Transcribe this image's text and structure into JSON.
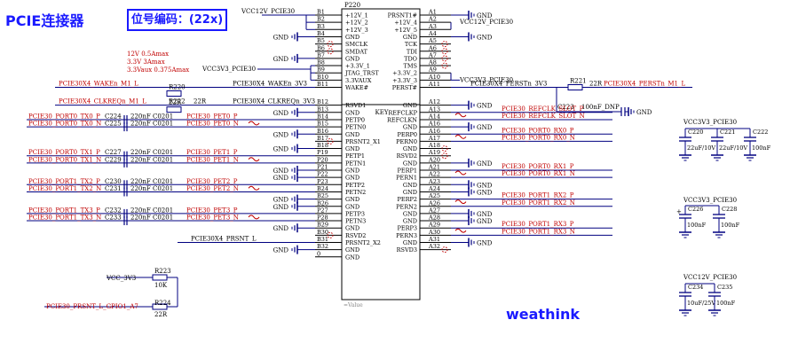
{
  "title": "PCIE连接器",
  "ref_label": "位号编码：(22x)",
  "brand": "weathink",
  "connector": {
    "ref": "P220",
    "key": "KEY",
    "value": "=Value",
    "left_pins": [
      {
        "num": "B1",
        "name": "+12V_1",
        "net": "VCC12V_PCIE30"
      },
      {
        "num": "B2",
        "name": "+12V_2",
        "net": ""
      },
      {
        "num": "B3",
        "name": "+12V_3",
        "net": ""
      },
      {
        "num": "B4",
        "name": "GND",
        "net": "GND"
      },
      {
        "num": "B5",
        "name": "SMCLK",
        "net": ""
      },
      {
        "num": "B6",
        "name": "SMDAT",
        "net": ""
      },
      {
        "num": "B7",
        "name": "GND",
        "net": "GND"
      },
      {
        "num": "B8",
        "name": "+3.3V_1",
        "net": "VCC3V3_PCIE30"
      },
      {
        "num": "B9",
        "name": "JTAG_TRST",
        "net": ""
      },
      {
        "num": "B10",
        "name": "3.3VAUX",
        "net": ""
      },
      {
        "num": "B11",
        "name": "WAKE#",
        "net": "PCIE30X4_WAKEn_3V3"
      },
      {
        "num": "B12",
        "name": "RSVD1",
        "net": "PCIE30X4_CLKREQn_3V3"
      },
      {
        "num": "B13",
        "name": "GND",
        "net": "GND"
      },
      {
        "num": "B14",
        "name": "PETP0",
        "net": "PCIE30_PET0_P"
      },
      {
        "num": "B15",
        "name": "PETN0",
        "net": "PCIE30_PET0_N"
      },
      {
        "num": "B16",
        "name": "GND",
        "net": "GND"
      },
      {
        "num": "B17",
        "name": "PRSNT2_X1",
        "net": ""
      },
      {
        "num": "B18",
        "name": "GND",
        "net": "GND"
      },
      {
        "num": "P19",
        "name": "PETP1",
        "net": "PCIE30_PET1_P"
      },
      {
        "num": "P20",
        "name": "PETN1",
        "net": "PCIE30_PET1_N"
      },
      {
        "num": "P21",
        "name": "GND",
        "net": "GND"
      },
      {
        "num": "P22",
        "name": "GND",
        "net": "GND"
      },
      {
        "num": "P23",
        "name": "PETP2",
        "net": "PCIE30_PET2_P"
      },
      {
        "num": "B24",
        "name": "PETN2",
        "net": "PCIE30_PET2_N"
      },
      {
        "num": "B25",
        "name": "GND",
        "net": "GND"
      },
      {
        "num": "B26",
        "name": "GND",
        "net": "GND"
      },
      {
        "num": "P27",
        "name": "PETP3",
        "net": "PCIE30_PET3_P"
      },
      {
        "num": "P28",
        "name": "PETN3",
        "net": "PCIE30_PET3_N"
      },
      {
        "num": "B29",
        "name": "GND",
        "net": "GND"
      },
      {
        "num": "B30",
        "name": "RSVD2",
        "net": ""
      },
      {
        "num": "B31",
        "name": "PRSNT2_X2",
        "net": "PCIE30X4_PRSNT_L"
      },
      {
        "num": "B32",
        "name": "GND",
        "net": "GND"
      },
      {
        "num": "0",
        "name": "GND",
        "net": ""
      }
    ],
    "right_pins": [
      {
        "num": "A1",
        "name": "PRSNT1#",
        "net": "GND"
      },
      {
        "num": "A2",
        "name": "+12V_4",
        "net": "VCC12V_PCIE30"
      },
      {
        "num": "A3",
        "name": "+12V_5",
        "net": ""
      },
      {
        "num": "A4",
        "name": "GND",
        "net": "GND"
      },
      {
        "num": "A5",
        "name": "TCK",
        "net": ""
      },
      {
        "num": "A6",
        "name": "TDI",
        "net": ""
      },
      {
        "num": "A7",
        "name": "TDO",
        "net": ""
      },
      {
        "num": "A8",
        "name": "TMS",
        "net": ""
      },
      {
        "num": "A9",
        "name": "+3.3V_2",
        "net": ""
      },
      {
        "num": "A10",
        "name": "+3.3V_3",
        "net": "VCC3V3_PCIE30"
      },
      {
        "num": "A11",
        "name": "PERST#",
        "net": "PCIE30X4_PERSTn_3V3"
      },
      {
        "num": "A12",
        "name": "GND",
        "net": "GND"
      },
      {
        "num": "A13",
        "name": "REFCLKP",
        "net": "PCIE30_REFCLK_SLOT_P"
      },
      {
        "num": "A14",
        "name": "REFCLKN",
        "net": "PCIE30_REFCLK_SLOT_N"
      },
      {
        "num": "A16",
        "name": "GND",
        "net": "GND"
      },
      {
        "num": "A16",
        "name": "PERP0",
        "net": "PCIE30_PORT0_RX0_P"
      },
      {
        "num": "A17",
        "name": "PERN0",
        "net": "PCIE30_PORT0_RX0_N"
      },
      {
        "num": "A18",
        "name": "GND",
        "net": ""
      },
      {
        "num": "A19",
        "name": "RSVD2",
        "net": ""
      },
      {
        "num": "A20",
        "name": "GND",
        "net": "GND"
      },
      {
        "num": "A21",
        "name": "PERP1",
        "net": "PCIE30_PORT0_RX1_P"
      },
      {
        "num": "A22",
        "name": "PERN1",
        "net": "PCIE30_PORT0_RX1_N"
      },
      {
        "num": "A23",
        "name": "GND",
        "net": "GND"
      },
      {
        "num": "A24",
        "name": "GND",
        "net": "GND"
      },
      {
        "num": "A25",
        "name": "PERP2",
        "net": "PCIE30_PORT1_RX2_P"
      },
      {
        "num": "A26",
        "name": "PERN2",
        "net": "PCIE30_PORT1_RX2_N"
      },
      {
        "num": "A27",
        "name": "GND",
        "net": "GND"
      },
      {
        "num": "A28",
        "name": "GND",
        "net": "GND"
      },
      {
        "num": "A29",
        "name": "PERP3",
        "net": "PCIE30_PORT1_RX3_P"
      },
      {
        "num": "A30",
        "name": "PERN3",
        "net": "PCIE30_PORT1_RX3_N"
      },
      {
        "num": "A31",
        "name": "GND",
        "net": "GND"
      },
      {
        "num": "A32",
        "name": "RSVD3",
        "net": ""
      }
    ]
  },
  "left_inputs": [
    {
      "net": "PCIE30X4_WAKEn_M1_L",
      "ref": "R220",
      "value": "22R"
    },
    {
      "net": "PCIE30X4_CLKREQn_M1_L",
      "ref": "R222",
      "value": "22R"
    },
    {
      "net": "VCC_3V3",
      "ref": "R223",
      "value": "10K"
    },
    {
      "net": "PCIE30_PRSNT_L_GPIO1_A7",
      "ref": "R224",
      "value": "22R"
    }
  ],
  "tx_caps": [
    {
      "net": "PCIE30_PORT0_TX0_P",
      "ref": "C224",
      "value": "220nF",
      "pkg": "C0201"
    },
    {
      "net": "PCIE30_PORT0_TX0_N",
      "ref": "C225",
      "value": "220nF",
      "pkg": "C0201"
    },
    {
      "net": "PCIE30_PORT0_TX1_P",
      "ref": "C227",
      "value": "220nF",
      "pkg": "C0201"
    },
    {
      "net": "PCIE30_PORT0_TX1_N",
      "ref": "C229",
      "value": "220nF",
      "pkg": "C0201"
    },
    {
      "net": "PCIE30_PORT1_TX2_P",
      "ref": "C230",
      "value": "220nF",
      "pkg": "C0201"
    },
    {
      "net": "PCIE30_PORT1_TX2_N",
      "ref": "C231",
      "value": "220nF",
      "pkg": "C0201"
    },
    {
      "net": "PCIE30_PORT1_TX3_P",
      "ref": "C232",
      "value": "220nF",
      "pkg": "C0201"
    },
    {
      "net": "PCIE30_PORT1_TX3_N",
      "ref": "C233",
      "value": "220nF",
      "pkg": "C0201"
    }
  ],
  "power_notes": [
    "12V 0.5Amax",
    "3.3V 3Amax",
    "3.3Vaux 0.375Amax"
  ],
  "perst": {
    "ref": "R221",
    "value": "22R",
    "out_net": "PCIE30X4_PERSTn_M1_L",
    "cap_ref": "C223",
    "cap_value": "100nF_DNP"
  },
  "decoupling": {
    "group1": {
      "net": "VCC3V3_PCIE30",
      "caps": [
        {
          "ref": "C220",
          "value": "22uF/10V"
        },
        {
          "ref": "C221",
          "value": "22uF/10V"
        },
        {
          "ref": "C222",
          "value": "100nF"
        }
      ]
    },
    "group2": {
      "net": "VCC3V3_PCIE30",
      "caps": [
        {
          "ref": "C226",
          "value": "100nF"
        },
        {
          "ref": "C228",
          "value": "100nF"
        }
      ]
    },
    "group3": {
      "net": "VCC12V_PCIE30",
      "caps": [
        {
          "ref": "C234",
          "value": "10uF/25V"
        },
        {
          "ref": "C235",
          "value": "100nF"
        }
      ]
    }
  },
  "gnd_label": "GND",
  "colors": {
    "wire": "#000080",
    "net_red": "#c00000",
    "text_blue": "#1a1aff",
    "body": "#000000"
  }
}
